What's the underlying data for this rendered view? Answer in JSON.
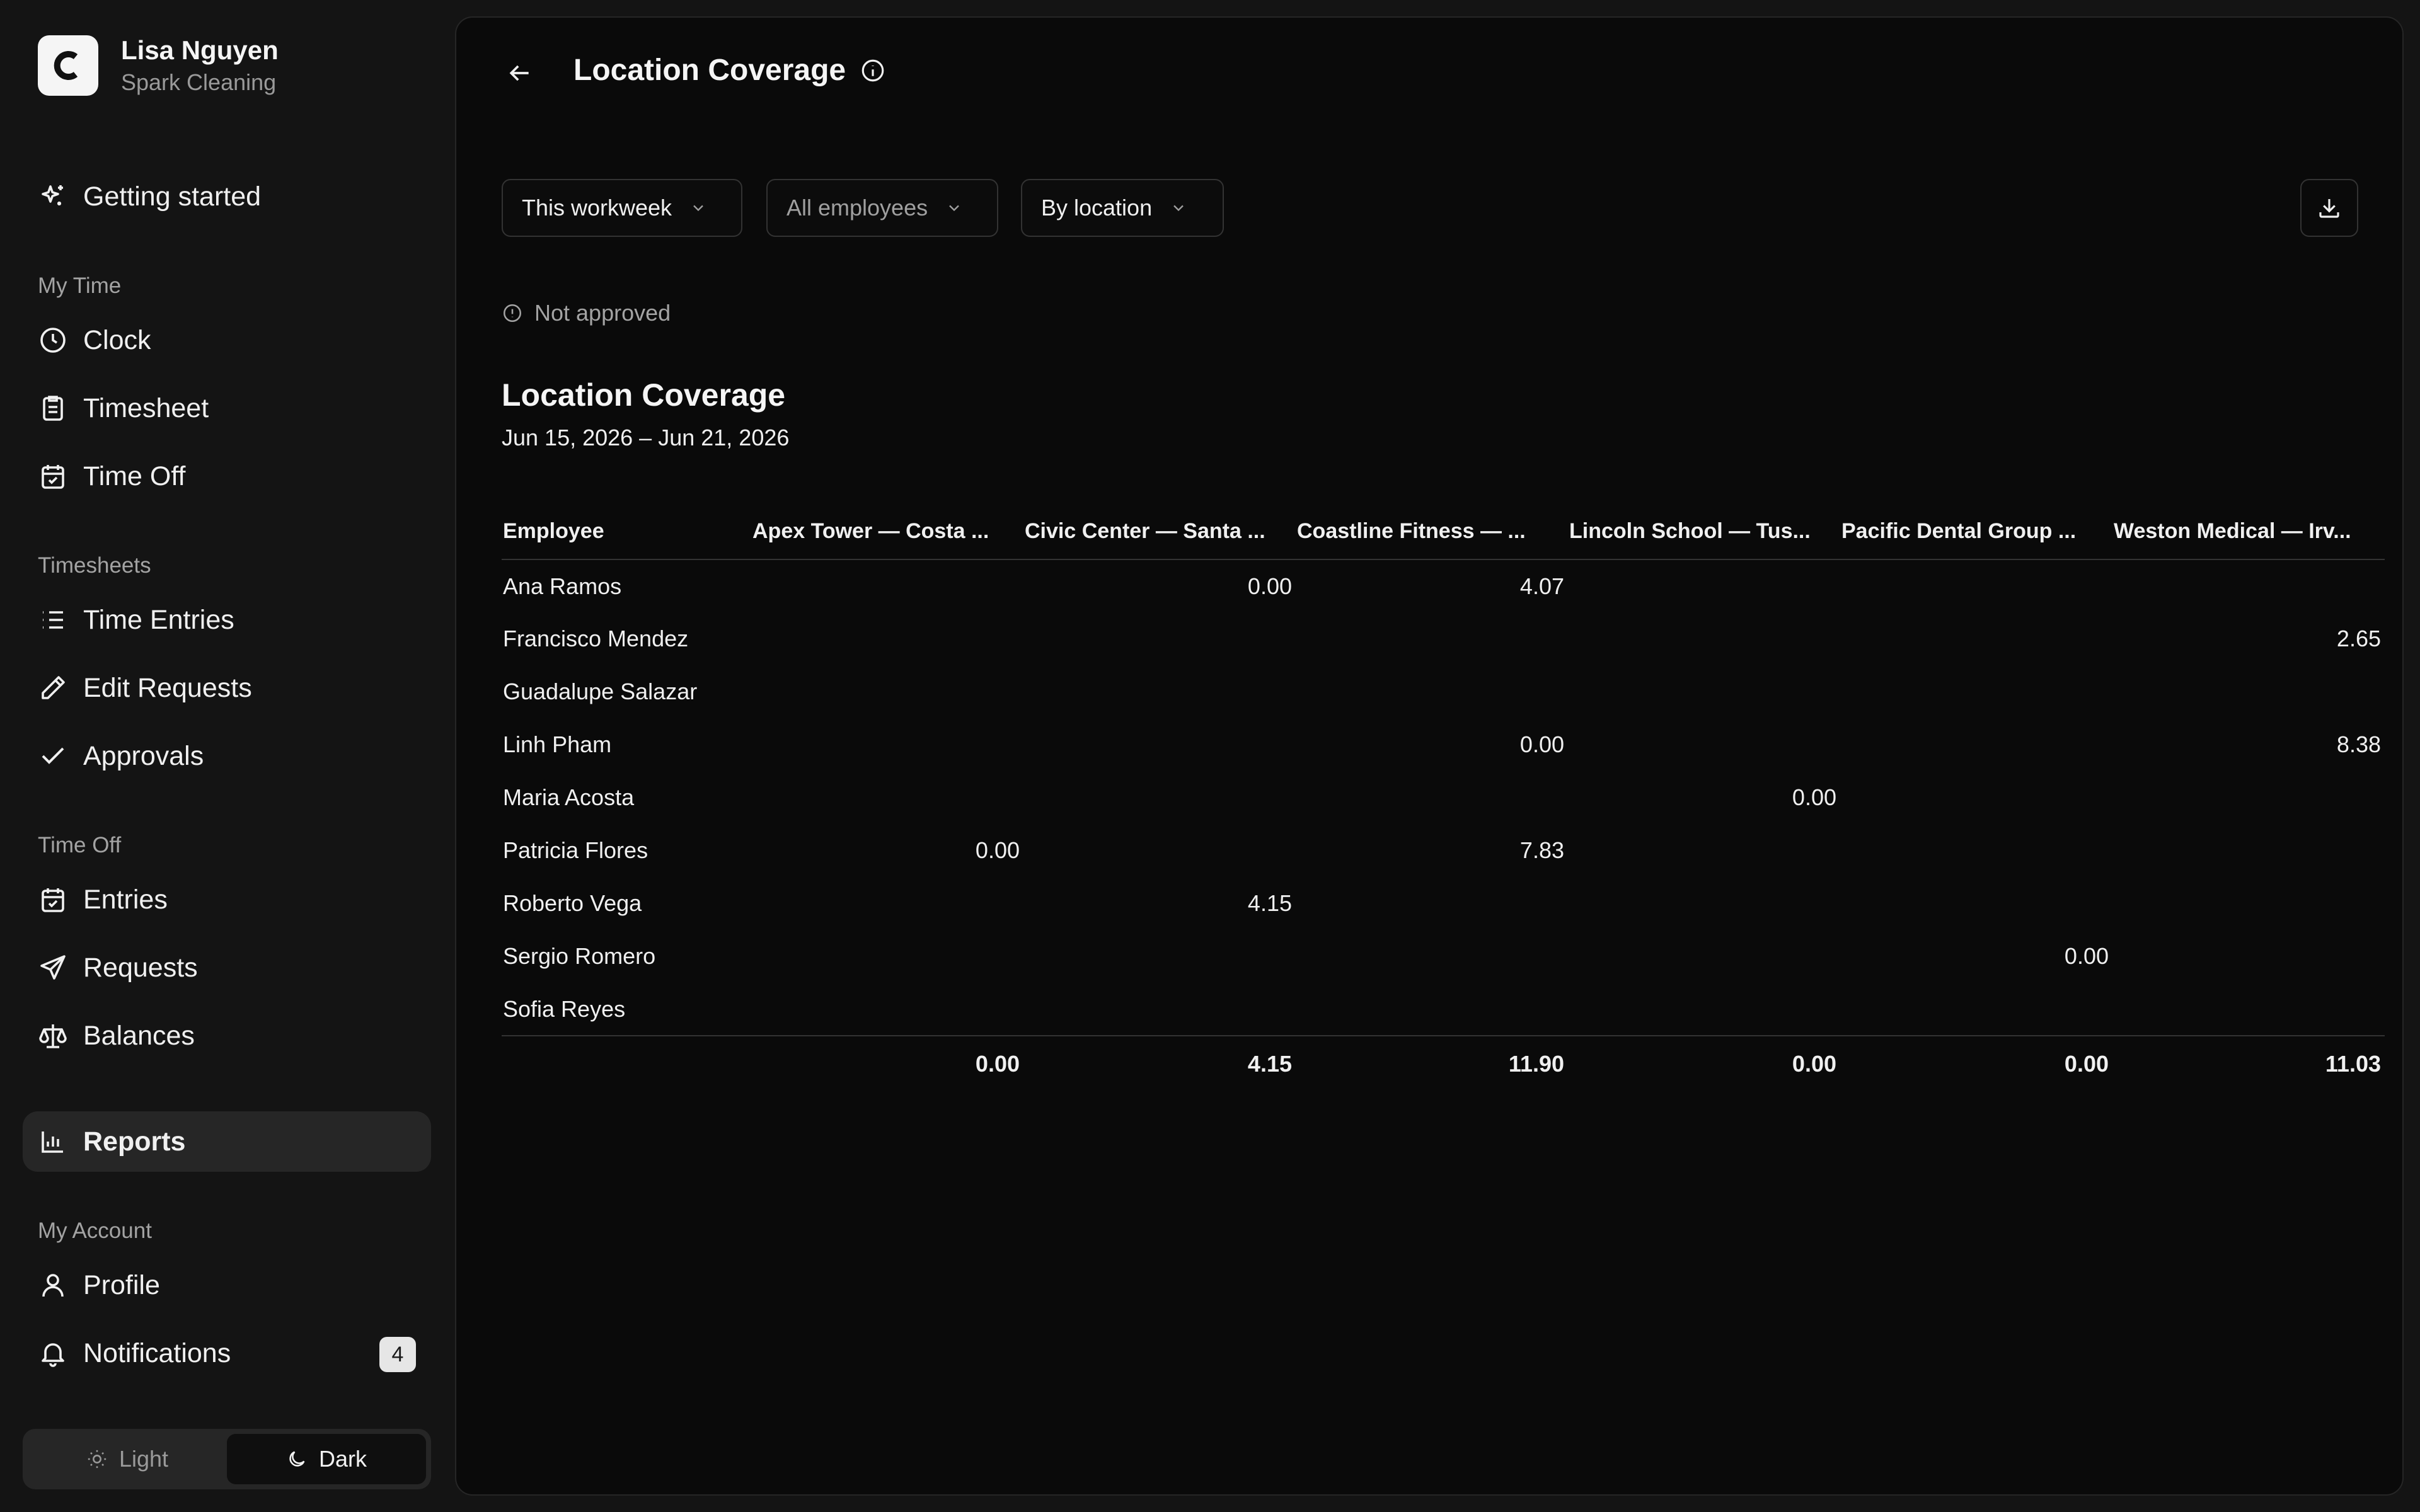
{
  "org": {
    "user_name": "Lisa Nguyen",
    "company": "Spark Cleaning",
    "logo_letter": "C"
  },
  "nav": {
    "getting_started": "Getting started",
    "section_my_time": "My Time",
    "clock": "Clock",
    "timesheet": "Timesheet",
    "time_off": "Time Off",
    "section_timesheets": "Timesheets",
    "time_entries": "Time Entries",
    "edit_requests": "Edit Requests",
    "approvals": "Approvals",
    "section_time_off": "Time Off",
    "entries": "Entries",
    "requests": "Requests",
    "balances": "Balances",
    "reports": "Reports",
    "section_my_account": "My Account",
    "profile": "Profile",
    "notifications": "Notifications",
    "notifications_count": "4"
  },
  "theme": {
    "light": "Light",
    "dark": "Dark",
    "selected": "Dark"
  },
  "page": {
    "title": "Location Coverage",
    "filters": {
      "period": "This workweek",
      "employees": "All employees",
      "group_by": "By location"
    },
    "status": "Not approved",
    "report_title": "Location Coverage",
    "report_range": "Jun 15, 2026 – Jun 21, 2026"
  },
  "table": {
    "columns": [
      "Employee",
      "Apex Tower — Costa ...",
      "Civic Center — Santa ...",
      "Coastline Fitness — ...",
      "Lincoln School — Tus...",
      "Pacific Dental Group ...",
      "Weston Medical — Irv..."
    ],
    "rows": [
      [
        "Ana Ramos",
        "",
        "0.00",
        "4.07",
        "",
        "",
        ""
      ],
      [
        "Francisco Mendez",
        "",
        "",
        "",
        "",
        "",
        "2.65"
      ],
      [
        "Guadalupe Salazar",
        "",
        "",
        "",
        "",
        "",
        ""
      ],
      [
        "Linh Pham",
        "",
        "",
        "0.00",
        "",
        "",
        "8.38"
      ],
      [
        "Maria Acosta",
        "",
        "",
        "",
        "0.00",
        "",
        ""
      ],
      [
        "Patricia Flores",
        "0.00",
        "",
        "7.83",
        "",
        "",
        ""
      ],
      [
        "Roberto Vega",
        "",
        "4.15",
        "",
        "",
        "",
        ""
      ],
      [
        "Sergio Romero",
        "",
        "",
        "",
        "",
        "0.00",
        ""
      ],
      [
        "Sofia Reyes",
        "",
        "",
        "",
        "",
        "",
        ""
      ]
    ],
    "totals": [
      "",
      "0.00",
      "4.15",
      "11.90",
      "0.00",
      "0.00",
      "11.03"
    ]
  }
}
